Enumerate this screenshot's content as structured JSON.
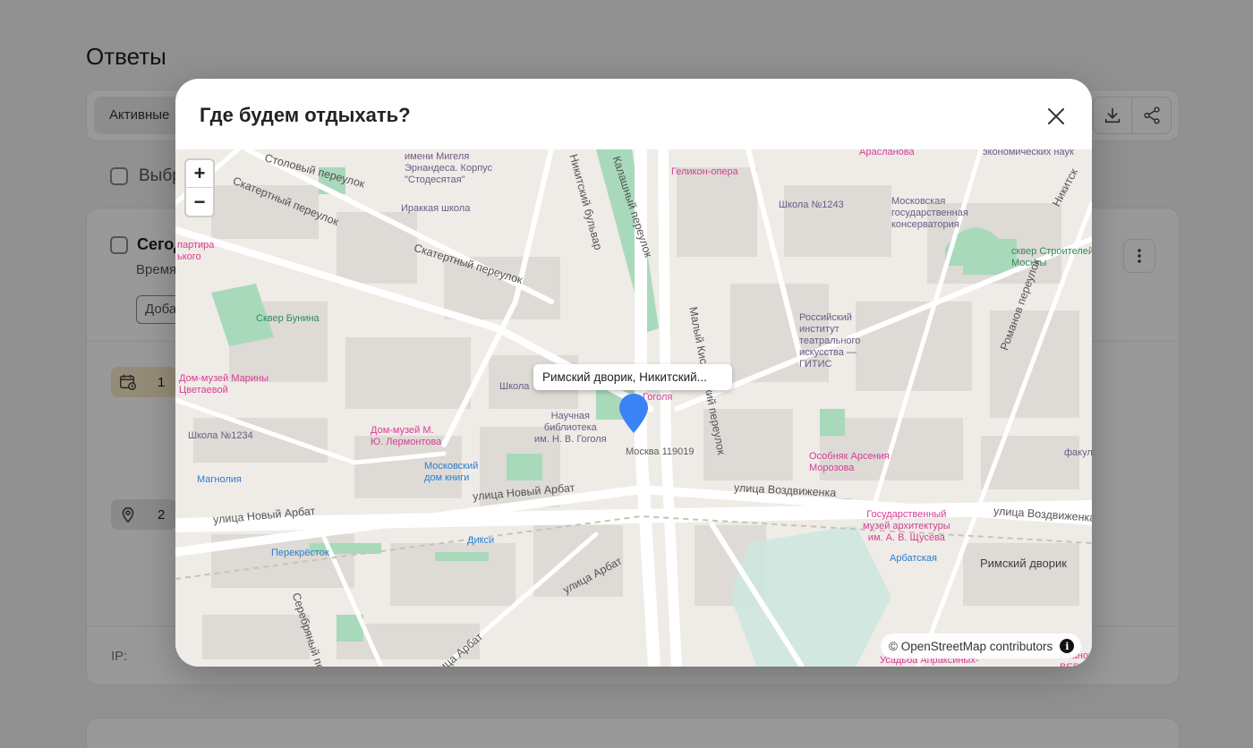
{
  "page": {
    "title": "Ответы",
    "filter_tab": "Активные",
    "select_all": "Выбрать все",
    "card": {
      "heading": "Сегодня",
      "subtitle": "Время",
      "add_button": "Добавить",
      "date_answer_count": "1",
      "place_answer_count": "2",
      "ip_label": "IP:"
    }
  },
  "modal": {
    "title": "Где будем отдыхать?",
    "map": {
      "popup_text": "Римский дворик, Никитский...",
      "attribution": "© OpenStreetMap contributors",
      "zoom_in": "+",
      "zoom_out": "−",
      "labels": [
        {
          "text": "Столовый переулок",
          "cls": "road"
        },
        {
          "text": "имени Мигеля\nЭрнандеса. Корпус\n\"Стодесятая\"",
          "cls": "purple"
        },
        {
          "text": "Ираккая школа",
          "cls": "purple"
        },
        {
          "text": "Скатертный переулок",
          "cls": "road"
        },
        {
          "text": "Скатертный переулок",
          "cls": "road"
        },
        {
          "text": "Геликон-опера",
          "cls": "pink"
        },
        {
          "text": "Арасланова",
          "cls": "pink"
        },
        {
          "text": "экономических наук",
          "cls": "purple"
        },
        {
          "text": "Школа №1243",
          "cls": "purple"
        },
        {
          "text": "Московская\nгосударственная\nконсерватория",
          "cls": "purple"
        },
        {
          "text": "сквер Строителей\nМосквы",
          "cls": "green"
        },
        {
          "text": "Малый Кисловский переулок",
          "cls": "road"
        },
        {
          "text": "Российский\nинститут\nтеатрального\nискусства —\nГИТИС",
          "cls": "purple"
        },
        {
          "text": "Романов переулок",
          "cls": "road"
        },
        {
          "text": "Сквер Бунина",
          "cls": "green"
        },
        {
          "text": "партира\nького",
          "cls": "pink"
        },
        {
          "text": "Дом-музей Марины\nЦветаевой",
          "cls": "pink"
        },
        {
          "text": "Школа",
          "cls": "purple"
        },
        {
          "text": "Гоголя",
          "cls": "pink"
        },
        {
          "text": "Научная\nбиблиотека\nим. Н. В. Гоголя",
          "cls": "purple"
        },
        {
          "text": "Москва 119019",
          "cls": ""
        },
        {
          "text": "Школа №1234",
          "cls": "purple"
        },
        {
          "text": "Дом-музей М.\nЮ. Лермонтова",
          "cls": "pink"
        },
        {
          "text": "Московский\nдом книги",
          "cls": "blue"
        },
        {
          "text": "Магнолия",
          "cls": "blue"
        },
        {
          "text": "Особняк Арсения\nМорозова",
          "cls": "pink"
        },
        {
          "text": "факул",
          "cls": "purple"
        },
        {
          "text": "улица Новый Арбат",
          "cls": "road"
        },
        {
          "text": "улица Новый Арбат",
          "cls": "road"
        },
        {
          "text": "улица Воздвиженка",
          "cls": "road"
        },
        {
          "text": "улица Воздвиженка",
          "cls": "road"
        },
        {
          "text": "Государственный\nмузей архитектуры\nим. А. В. Щусева",
          "cls": "pink"
        },
        {
          "text": "Арбатская",
          "cls": "blue"
        },
        {
          "text": "Римский дворик",
          "cls": "big"
        },
        {
          "text": "Дикси",
          "cls": "blue"
        },
        {
          "text": "Перекрёсток",
          "cls": "blue"
        },
        {
          "text": "улица Арбат",
          "cls": "road"
        },
        {
          "text": "Серебряный пе",
          "cls": "road"
        },
        {
          "text": "улица Арбат",
          "cls": "road"
        },
        {
          "text": "Никитский бульвар",
          "cls": "road"
        },
        {
          "text": "Калашный переулок",
          "cls": "road"
        },
        {
          "text": "Никитск",
          "cls": "road"
        },
        {
          "text": "Усадьба Апраксиных-",
          "cls": "pink"
        },
        {
          "text": "Ивановский\nВЕБ",
          "cls": "pink"
        }
      ]
    }
  },
  "colors": {
    "marker": "#3b82f6",
    "park": "#9bd3b2",
    "road": "#ffffff",
    "building": "#dedad5"
  }
}
